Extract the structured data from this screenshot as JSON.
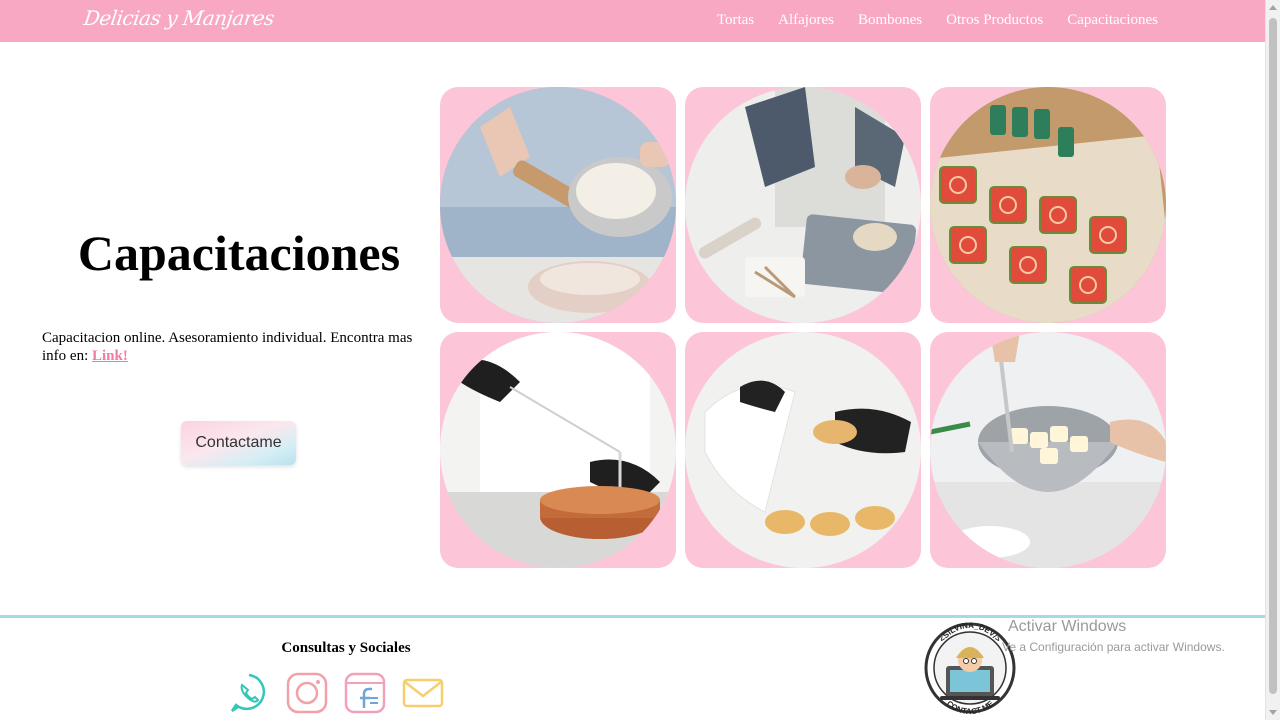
{
  "navbar": {
    "brand": "Delicias y Manjares",
    "links": [
      "Tortas",
      "Alfajores",
      "Bombones",
      "Otros Productos",
      "Capacitaciones"
    ]
  },
  "hero": {
    "title": "Capacitaciones",
    "description": "Capacitacion online. Asesoramiento individual. Encontra mas info en: ",
    "link_label": "Link!",
    "button_label": "Contactame"
  },
  "gallery": {
    "photos": [
      "sifting-flour-photo",
      "kneading-dough-photo",
      "spiral-cookies-photo",
      "cutting-cake-photo",
      "piping-cookies-photo",
      "mixing-bowl-photo"
    ]
  },
  "footer": {
    "title": "Consultas y Sociales",
    "socials": [
      "whatsapp-icon",
      "instagram-icon",
      "facebook-icon",
      "email-icon"
    ],
    "sticker_top": "<SILVINA_DEV/>",
    "sticker_bottom": "CONTACT ME"
  },
  "watermark": {
    "line1": "Activar Windows",
    "line2": "Ve a Configuración para activar Windows."
  },
  "colors": {
    "navbar": "#f9a8c4",
    "card": "#fcc6d8",
    "link": "#f37aa0",
    "footer_line": "#a9d8e5"
  }
}
